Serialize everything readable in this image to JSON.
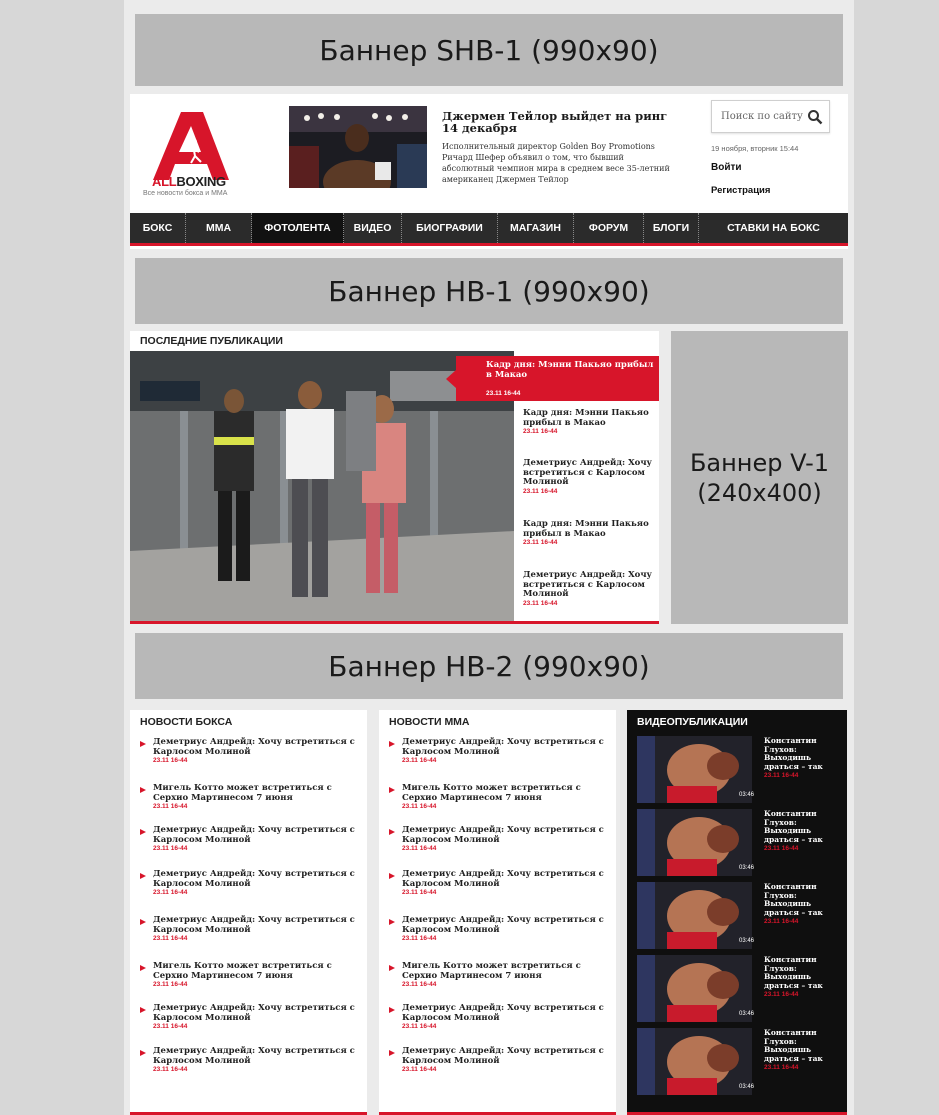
{
  "banners": {
    "shb1": "Баннер SHB-1 (990x90)",
    "hb1": "Баннер HB-1 (990x90)",
    "hb2": "Баннер HB-2 (990x90)",
    "v1_line1": "Баннер V-1",
    "v1_line2": "(240x400)"
  },
  "header": {
    "logo_text_red": "ALL",
    "logo_text_dark": "BOXING",
    "logo_tagline": "Все новости бокса и ММА",
    "hero_title": "Джермен Тейлор выйдет на ринг 14 декабря",
    "hero_text": "Исполнительный директор Golden Boy Promotions Ричард Шефер объявил о том, что бывший абсолютный чемпион мира в среднем весе 35-летний американец Джермен Тейлор",
    "search_placeholder": "Поиск по сайту",
    "search_icon": "search-icon",
    "date": "19 ноября, вторник 15:44",
    "login": "Войти",
    "register": "Регистрация"
  },
  "nav": {
    "items": [
      "БОКС",
      "ММА",
      "ФОТОЛЕНТА",
      "ВИДЕО",
      "БИОГРАФИИ",
      "МАГАЗИН",
      "ФОРУМ",
      "БЛОГИ",
      "СТАВКИ НА БОКС"
    ],
    "active": "ФОТОЛЕНТА"
  },
  "latest": {
    "title": "ПОСЛЕДНИЕ ПУБЛИКАЦИИ",
    "featured_title": "Кадр дня: Мэнни Пакьяо прибыл в Макао",
    "featured_time": "23.11 16-44",
    "items": [
      {
        "title": "Кадр дня: Мэнни Пакьяо прибыл в Макао",
        "time": "23.11 16-44"
      },
      {
        "title": "Деметриус Андрейд: Хочу встретиться с Карлосом Молиной",
        "time": "23.11 16-44"
      },
      {
        "title": "Кадр дня: Мэнни Пакьяо прибыл в Макао",
        "time": "23.11 16-44"
      },
      {
        "title": "Деметриус Андрейд: Хочу встретиться с Карлосом Молиной",
        "time": "23.11 16-44"
      }
    ]
  },
  "boxing_news": {
    "title": "НОВОСТИ БОКСА",
    "items": [
      {
        "title": "Деметриус Андрейд: Хочу встретиться с Карлосом Молиной",
        "time": "23.11 16-44"
      },
      {
        "title": "Мигель Котто может встретиться с Серхио Мартинесом 7 июня",
        "time": "23.11 16-44"
      },
      {
        "title": "Деметриус Андрейд: Хочу встретиться с Карлосом Молиной",
        "time": "23.11 16-44"
      },
      {
        "title": "Деметриус Андрейд: Хочу встретиться с Карлосом Молиной",
        "time": "23.11 16-44"
      },
      {
        "title": "Деметриус Андрейд: Хочу встретиться с Карлосом Молиной",
        "time": "23.11 16-44"
      },
      {
        "title": "Мигель Котто может встретиться с Серхио Мартинесом 7 июня",
        "time": "23.11 16-44"
      },
      {
        "title": "Деметриус Андрейд: Хочу встретиться с Карлосом Молиной",
        "time": "23.11 16-44"
      },
      {
        "title": "Деметриус Андрейд: Хочу встретиться с Карлосом Молиной",
        "time": "23.11 16-44"
      }
    ]
  },
  "mma_news": {
    "title": "НОВОСТИ ММА",
    "items": [
      {
        "title": "Деметриус Андрейд: Хочу встретиться с Карлосом Молиной",
        "time": "23.11 16-44"
      },
      {
        "title": "Мигель Котто может встретиться с Серхио Мартинесом 7 июня",
        "time": "23.11 16-44"
      },
      {
        "title": "Деметриус Андрейд: Хочу встретиться с Карлосом Молиной",
        "time": "23.11 16-44"
      },
      {
        "title": "Деметриус Андрейд: Хочу встретиться с Карлосом Молиной",
        "time": "23.11 16-44"
      },
      {
        "title": "Деметриус Андрейд: Хочу встретиться с Карлосом Молиной",
        "time": "23.11 16-44"
      },
      {
        "title": "Мигель Котто может встретиться с Серхио Мартинесом 7 июня",
        "time": "23.11 16-44"
      },
      {
        "title": "Деметриус Андрейд: Хочу встретиться с Карлосом Молиной",
        "time": "23.11 16-44"
      },
      {
        "title": "Деметриус Андрейд: Хочу встретиться с Карлосом Молиной",
        "time": "23.11 16-44"
      }
    ]
  },
  "video": {
    "title": "ВИДЕОПУБЛИКАЦИИ",
    "items": [
      {
        "title": "Константин Глухов: Выходишь драться – так",
        "time": "23.11 16-44",
        "duration": "03:46"
      },
      {
        "title": "Константин Глухов: Выходишь драться – так",
        "time": "23.11 16-44",
        "duration": "03:46"
      },
      {
        "title": "Константин Глухов: Выходишь драться – так",
        "time": "23.11 16-44",
        "duration": "03:46"
      },
      {
        "title": "Константин Глухов: Выходишь драться – так",
        "time": "23.11 16-44",
        "duration": "03:46"
      },
      {
        "title": "Константин Глухов: Выходишь драться – так",
        "time": "23.11 16-44",
        "duration": "03:46"
      }
    ]
  },
  "colors": {
    "accent": "#d7152a",
    "nav_bg": "#2b2b2b",
    "banner_bg": "#b8b8b8",
    "video_bg": "#0f0f0f"
  }
}
